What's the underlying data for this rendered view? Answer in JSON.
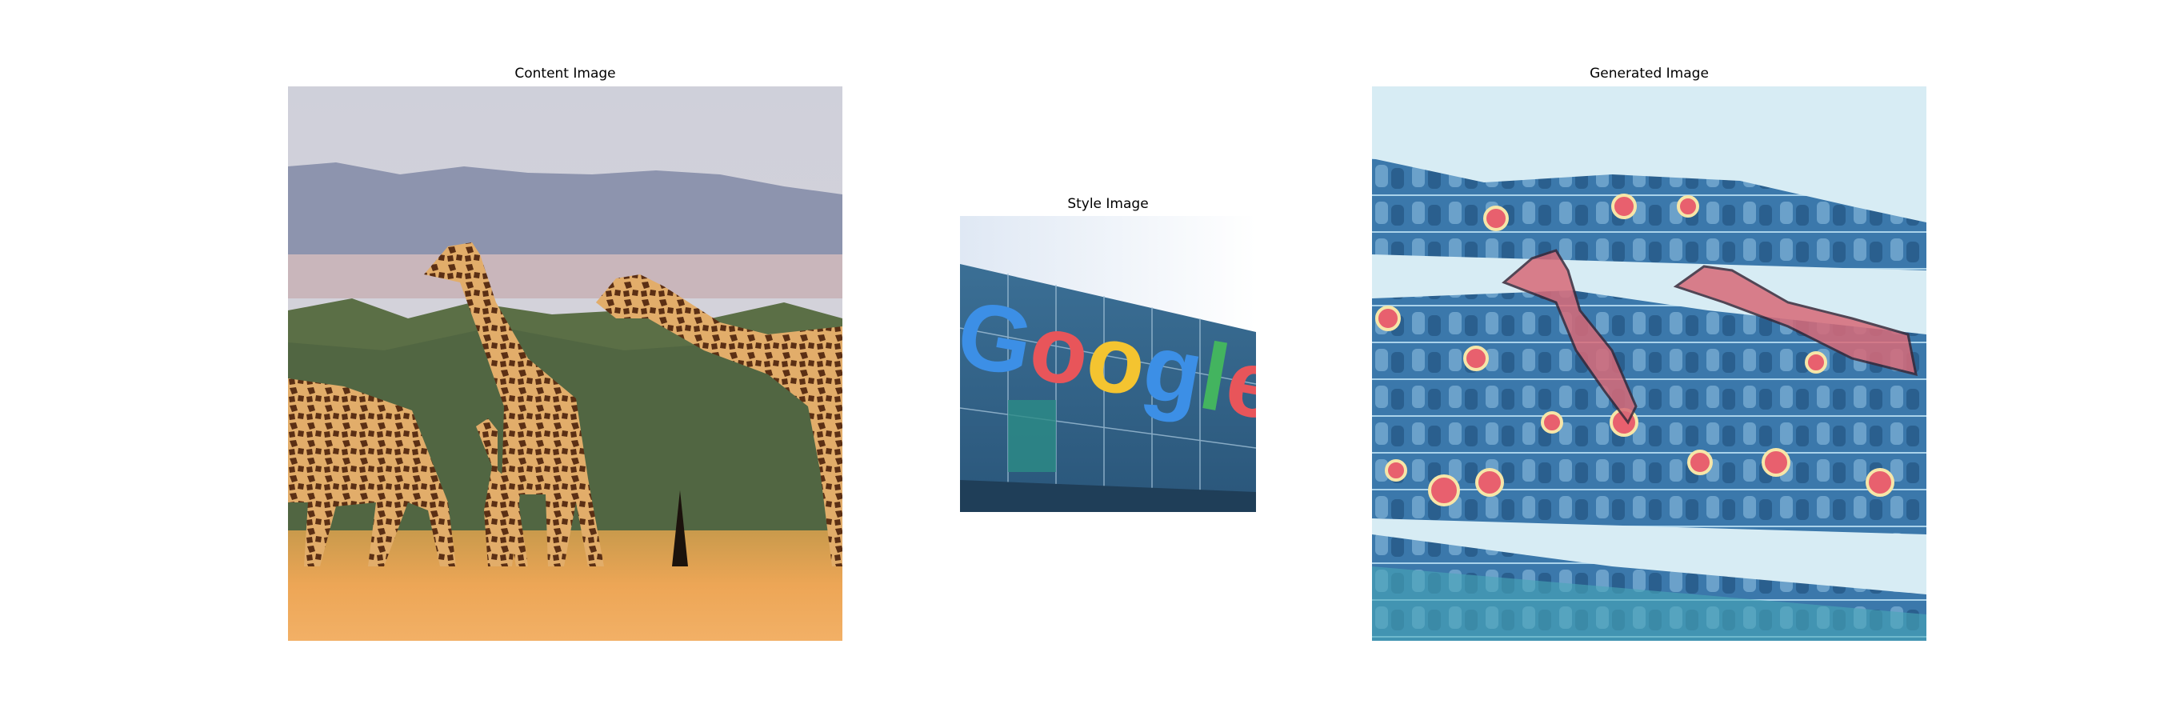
{
  "figure": {
    "panels": [
      {
        "title": "Content Image",
        "image": "giraffes-savanna"
      },
      {
        "title": "Style Image",
        "image": "google-building-logo",
        "logo_text": "Google"
      },
      {
        "title": "Generated Image",
        "image": "stylized-giraffes"
      }
    ]
  },
  "colors": {
    "background": "#ffffff",
    "google_blue": "#3c8fe6",
    "google_red": "#e8555a",
    "google_yellow": "#f4c430",
    "google_green": "#43b45f"
  }
}
